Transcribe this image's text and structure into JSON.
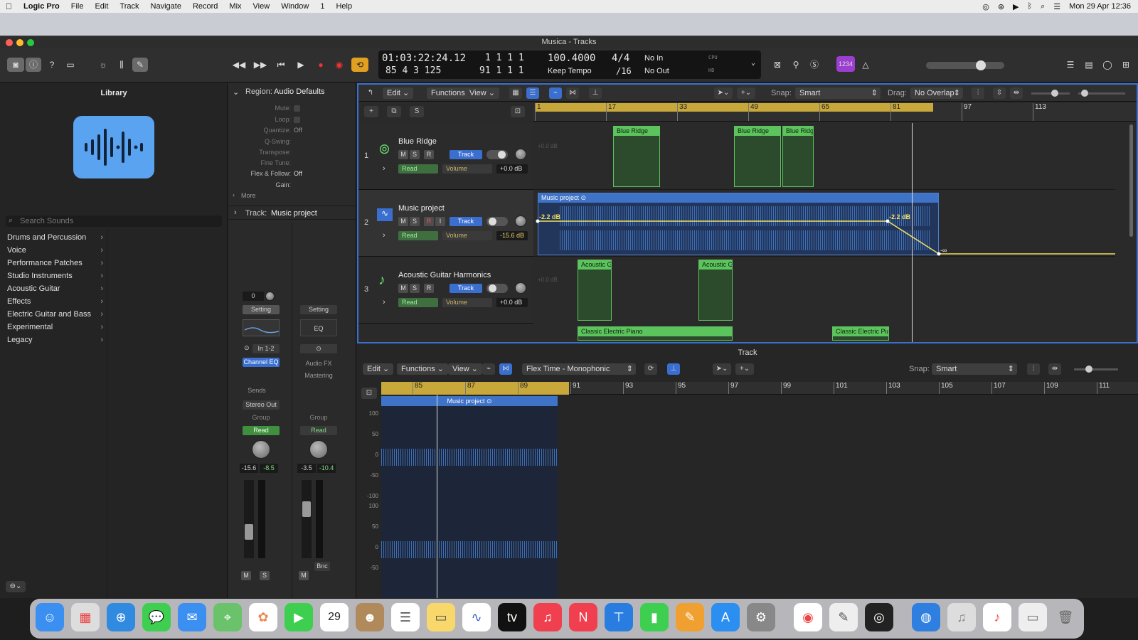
{
  "menubar": {
    "app": "Logic Pro",
    "items": [
      "File",
      "Edit",
      "Track",
      "Navigate",
      "Record",
      "Mix",
      "View",
      "Window",
      "1",
      "Help"
    ],
    "clock": "Mon 29 Apr  12:36"
  },
  "window": {
    "title": "Musica - Tracks"
  },
  "lcd": {
    "time": "01:03:22:24.12",
    "bars_top": "1  1  1     1",
    "tempo": "100.4000",
    "sig": "4/4",
    "in": "No In",
    "pos": "85  4  3  125",
    "bars_bottom": "91  1  1     1",
    "tempo_mode": "Keep Tempo",
    "div": "/16",
    "out": "No Out",
    "cpu": "CPU",
    "hd": "HD"
  },
  "badge": "1234",
  "library": {
    "title": "Library",
    "search_placeholder": "Search Sounds",
    "items": [
      "Drums and Percussion",
      "Voice",
      "Performance Patches",
      "Studio Instruments",
      "Acoustic Guitar",
      "Effects",
      "Electric Guitar and Bass",
      "Experimental",
      "Legacy"
    ]
  },
  "inspector": {
    "region_label": "Region:",
    "region_name": "Audio Defaults",
    "params": [
      {
        "k": "Mute:",
        "v": ""
      },
      {
        "k": "Loop:",
        "v": ""
      },
      {
        "k": "Quantize:",
        "v": "Off"
      },
      {
        "k": "Q-Swing:",
        "v": ""
      },
      {
        "k": "Transpose:",
        "v": ""
      },
      {
        "k": "Fine Tune:",
        "v": ""
      },
      {
        "k": "Flex & Follow:",
        "v": "Off"
      },
      {
        "k": "Gain:",
        "v": ""
      }
    ],
    "more": "More",
    "track_label": "Track:",
    "track_name": "Music project",
    "strip1": {
      "value": "0",
      "setting": "Setting",
      "input": "In 1-2",
      "eq": "Channel EQ",
      "sends": "Sends",
      "output": "Stereo Out",
      "group": "Group",
      "read": "Read",
      "vol": "-15.6",
      "peak": "-8.5",
      "m": "M",
      "s": "S"
    },
    "strip2": {
      "setting": "Setting",
      "eq": "EQ",
      "audiofx": "Audio FX",
      "mastering": "Mastering",
      "group": "Group",
      "read": "Read",
      "vol": "-3.5",
      "peak": "-10.4",
      "bnc": "Bnc",
      "m": "M"
    }
  },
  "tracks_toolbar": {
    "edit": "Edit",
    "functions": "Functions",
    "view": "View",
    "snap_label": "Snap:",
    "snap": "Smart",
    "drag_label": "Drag:",
    "drag": "No Overlap"
  },
  "ruler": [
    "1",
    "17",
    "33",
    "49",
    "65",
    "81",
    "97",
    "113"
  ],
  "tracks": [
    {
      "num": "1",
      "name": "Blue Ridge",
      "m": "M",
      "s": "S",
      "r": "R",
      "btn": "Track",
      "mode": "Read",
      "param": "Volume",
      "val": "+0.0 dB",
      "lane_db": "+0.0 dB"
    },
    {
      "num": "2",
      "name": "Music project",
      "m": "M",
      "s": "S",
      "r": "R",
      "i": "I",
      "btn": "Track",
      "mode": "Read",
      "param": "Volume",
      "val": "-15.6 dB"
    },
    {
      "num": "3",
      "name": "Acoustic Guitar Harmonics",
      "m": "M",
      "s": "S",
      "r": "R",
      "btn": "Track",
      "mode": "Read",
      "param": "Volume",
      "val": "+0.0 dB",
      "lane_db": "+0.0 dB"
    }
  ],
  "regions": {
    "blue_ridge": [
      "Blue Ridge",
      "Blue Ridge",
      "Blue Ridg"
    ],
    "music": "Music project",
    "auto_a": "-2.2 dB",
    "auto_b": "-2.2 dB",
    "auto_c": "-∞",
    "acoustic": [
      "Acoustic G",
      "Acoustic G"
    ],
    "piano": [
      "Classic Electric Piano",
      "Classic Electric Pia"
    ]
  },
  "editor": {
    "title": "Track",
    "edit": "Edit",
    "functions": "Functions",
    "view": "View",
    "flex": "Flex Time - Monophonic",
    "snap_label": "Snap:",
    "snap": "Smart",
    "region": "Music project",
    "ruler": [
      "85",
      "87",
      "89",
      "91",
      "93",
      "95",
      "97",
      "99",
      "101",
      "103",
      "105",
      "107",
      "109",
      "111"
    ],
    "scale": [
      "100",
      "50",
      "0",
      "-50",
      "-100",
      "100",
      "50",
      "0",
      "-50"
    ]
  }
}
